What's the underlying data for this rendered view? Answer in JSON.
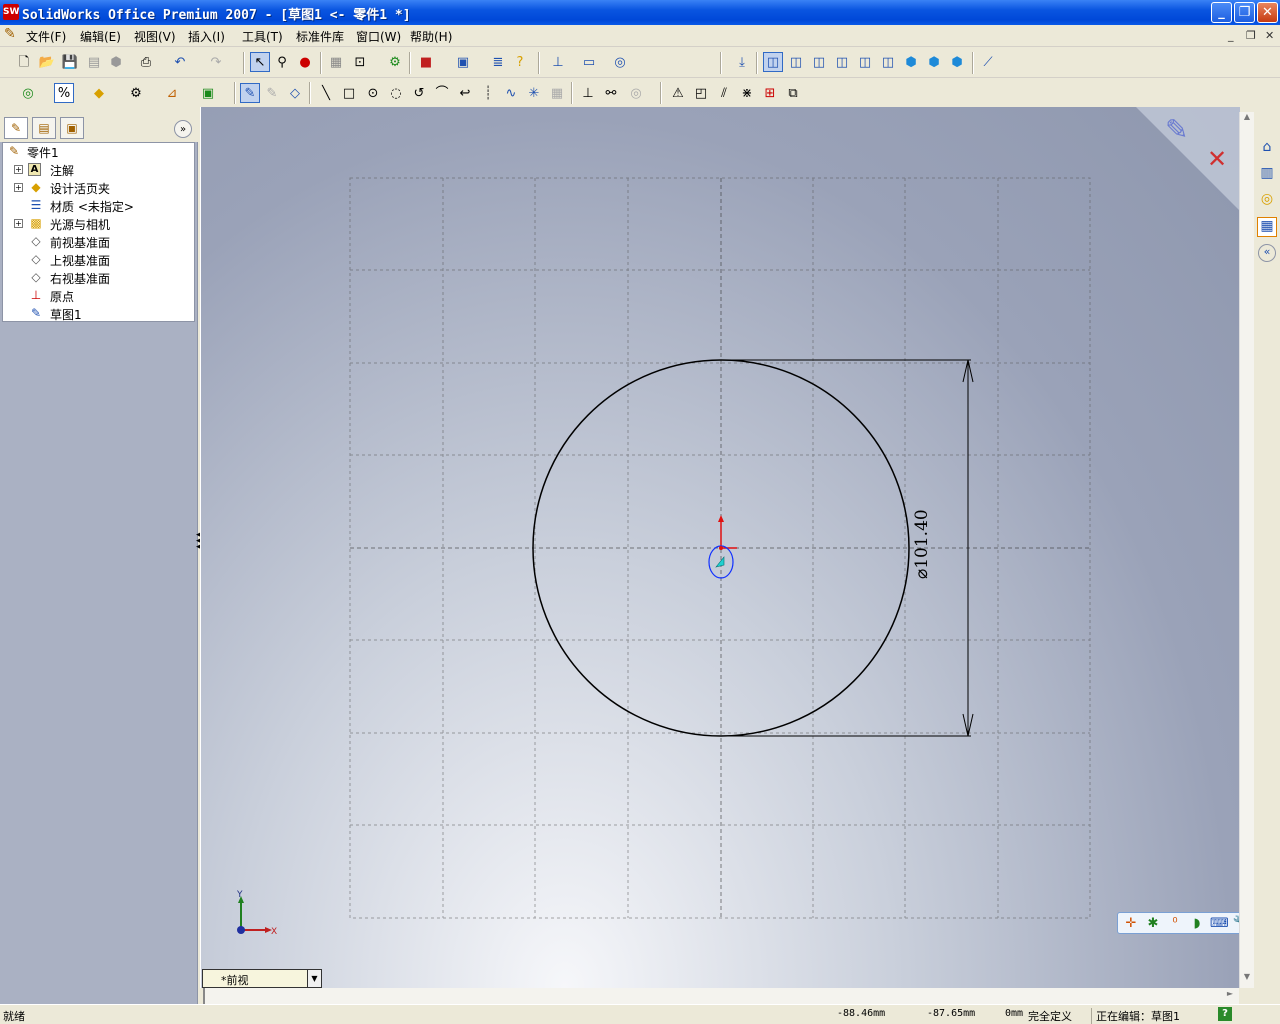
{
  "window": {
    "title": "SolidWorks Office Premium 2007 - [草图1 <- 零件1 *]",
    "app_icon": "SW"
  },
  "menubar": {
    "items": [
      "文件(F)",
      "编辑(E)",
      "视图(V)",
      "插入(I)",
      "工具(T)",
      "标准件库",
      "窗口(W)",
      "帮助(H)"
    ]
  },
  "tree": {
    "root": "零件1",
    "items": [
      {
        "label": "注解",
        "icon": "annotation-icon",
        "expandable": true
      },
      {
        "label": "设计活页夹",
        "icon": "design-binder-icon",
        "expandable": true
      },
      {
        "label": "材质 <未指定>",
        "icon": "material-icon",
        "expandable": false
      },
      {
        "label": "光源与相机",
        "icon": "lights-cameras-icon",
        "expandable": true
      },
      {
        "label": "前视基准面",
        "icon": "plane-icon",
        "expandable": false
      },
      {
        "label": "上视基准面",
        "icon": "plane-icon",
        "expandable": false
      },
      {
        "label": "右视基准面",
        "icon": "plane-icon",
        "expandable": false
      },
      {
        "label": "原点",
        "icon": "origin-icon",
        "expandable": false
      },
      {
        "label": "草图1",
        "icon": "sketch-icon",
        "expandable": false
      }
    ]
  },
  "sketch": {
    "dimension_text": "⌀101.40",
    "axis_x_label": "X",
    "axis_y_label": "Y"
  },
  "view_selector": {
    "value": "*前视"
  },
  "statusbar": {
    "ready": "就绪",
    "x_coord": "-88.46mm",
    "y_coord": "-87.65mm",
    "z_coord": "0mm",
    "constraint": "完全定义",
    "editing": "正在编辑：草图1",
    "help": "?"
  },
  "colors": {
    "title_bar": "#0a55e0",
    "sketch_line": "#000000",
    "origin_red": "#e01010",
    "selection_blue": "#1030ff"
  }
}
